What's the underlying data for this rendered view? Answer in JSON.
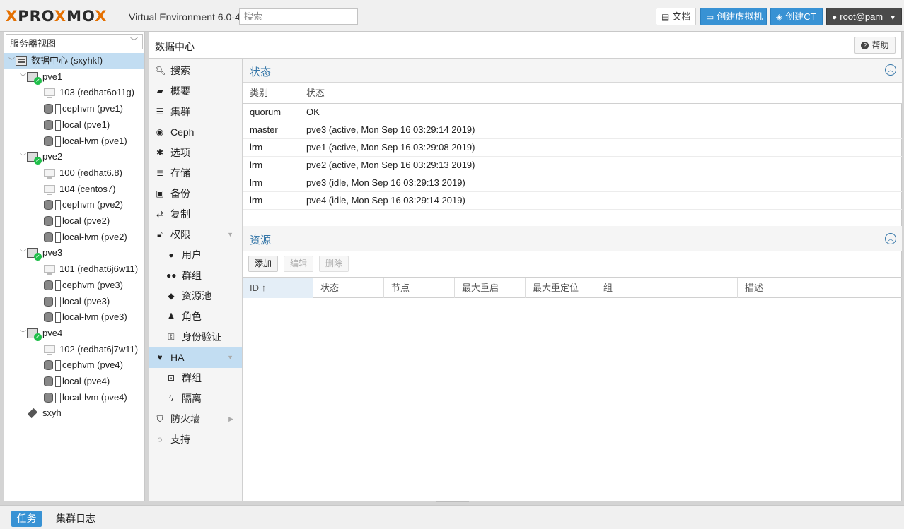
{
  "topbar": {
    "logo_left": "PRO",
    "logo_x1": "X",
    "logo_mid": "MO",
    "logo_x2": "X",
    "version": "Virtual Environment 6.0-4",
    "search_placeholder": "搜索",
    "docs_label": "文档",
    "create_vm_label": "创建虚拟机",
    "create_ct_label": "创建CT",
    "user_label": "root@pam"
  },
  "tree": {
    "view_select": "服务器视图",
    "nodes": [
      {
        "label": "数据中心 (sxyhkf)",
        "icon": "datacenter-icon"
      },
      {
        "label": "pve1",
        "icon": "node-online-icon"
      },
      {
        "label": "103 (redhat6o11g)",
        "icon": "vm-icon"
      },
      {
        "label": "cephvm (pve1)",
        "icon": "storage-icon"
      },
      {
        "label": "local (pve1)",
        "icon": "storage-icon"
      },
      {
        "label": "local-lvm (pve1)",
        "icon": "storage-icon"
      },
      {
        "label": "pve2",
        "icon": "node-online-icon"
      },
      {
        "label": "100 (redhat6.8)",
        "icon": "vm-icon"
      },
      {
        "label": "104 (centos7)",
        "icon": "vm-icon"
      },
      {
        "label": "cephvm (pve2)",
        "icon": "storage-icon"
      },
      {
        "label": "local (pve2)",
        "icon": "storage-icon"
      },
      {
        "label": "local-lvm (pve2)",
        "icon": "storage-icon"
      },
      {
        "label": "pve3",
        "icon": "node-online-icon"
      },
      {
        "label": "101 (redhat6j6w11)",
        "icon": "vm-icon"
      },
      {
        "label": "cephvm (pve3)",
        "icon": "storage-icon"
      },
      {
        "label": "local (pve3)",
        "icon": "storage-icon"
      },
      {
        "label": "local-lvm (pve3)",
        "icon": "storage-icon"
      },
      {
        "label": "pve4",
        "icon": "node-online-icon"
      },
      {
        "label": "102 (redhat6j7w11)",
        "icon": "vm-icon"
      },
      {
        "label": "cephvm (pve4)",
        "icon": "storage-icon"
      },
      {
        "label": "local (pve4)",
        "icon": "storage-icon"
      },
      {
        "label": "local-lvm (pve4)",
        "icon": "storage-icon"
      },
      {
        "label": "sxyh",
        "icon": "pool-tag-icon"
      }
    ]
  },
  "main": {
    "title": "数据中心",
    "help_label": "帮助",
    "nav": [
      {
        "label": "搜索",
        "icon": "search-icon"
      },
      {
        "label": "概要",
        "icon": "book-icon"
      },
      {
        "label": "集群",
        "icon": "server-icon"
      },
      {
        "label": "Ceph",
        "icon": "ceph-icon"
      },
      {
        "label": "选项",
        "icon": "gear-icon"
      },
      {
        "label": "存储",
        "icon": "database-icon"
      },
      {
        "label": "备份",
        "icon": "floppy-icon"
      },
      {
        "label": "复制",
        "icon": "retweet-icon"
      },
      {
        "label": "权限",
        "icon": "unlock-icon"
      },
      {
        "label": "用户",
        "icon": "user-icon"
      },
      {
        "label": "群组",
        "icon": "users-icon"
      },
      {
        "label": "资源池",
        "icon": "tags-icon"
      },
      {
        "label": "角色",
        "icon": "male-icon"
      },
      {
        "label": "身份验证",
        "icon": "key-icon"
      },
      {
        "label": "HA",
        "icon": "heartbeat-icon"
      },
      {
        "label": "群组",
        "icon": "object-group-icon"
      },
      {
        "label": "隔离",
        "icon": "bolt-icon"
      },
      {
        "label": "防火墙",
        "icon": "shield-icon"
      },
      {
        "label": "支持",
        "icon": "comments-icon"
      }
    ],
    "status": {
      "title": "状态",
      "headers": [
        "类别",
        "状态"
      ],
      "rows": [
        [
          "quorum",
          "OK"
        ],
        [
          "master",
          "pve3 (active, Mon Sep 16 03:29:14 2019)"
        ],
        [
          "lrm",
          "pve1 (active, Mon Sep 16 03:29:08 2019)"
        ],
        [
          "lrm",
          "pve2 (active, Mon Sep 16 03:29:13 2019)"
        ],
        [
          "lrm",
          "pve3 (idle, Mon Sep 16 03:29:13 2019)"
        ],
        [
          "lrm",
          "pve4 (idle, Mon Sep 16 03:29:14 2019)"
        ]
      ]
    },
    "resources": {
      "title": "资源",
      "add_label": "添加",
      "edit_label": "编辑",
      "delete_label": "删除",
      "headers": [
        "ID ↑",
        "状态",
        "节点",
        "最大重启",
        "最大重定位",
        "组",
        "描述"
      ]
    }
  },
  "bottombar": {
    "tasks_label": "任务",
    "cluster_log_label": "集群日志"
  }
}
